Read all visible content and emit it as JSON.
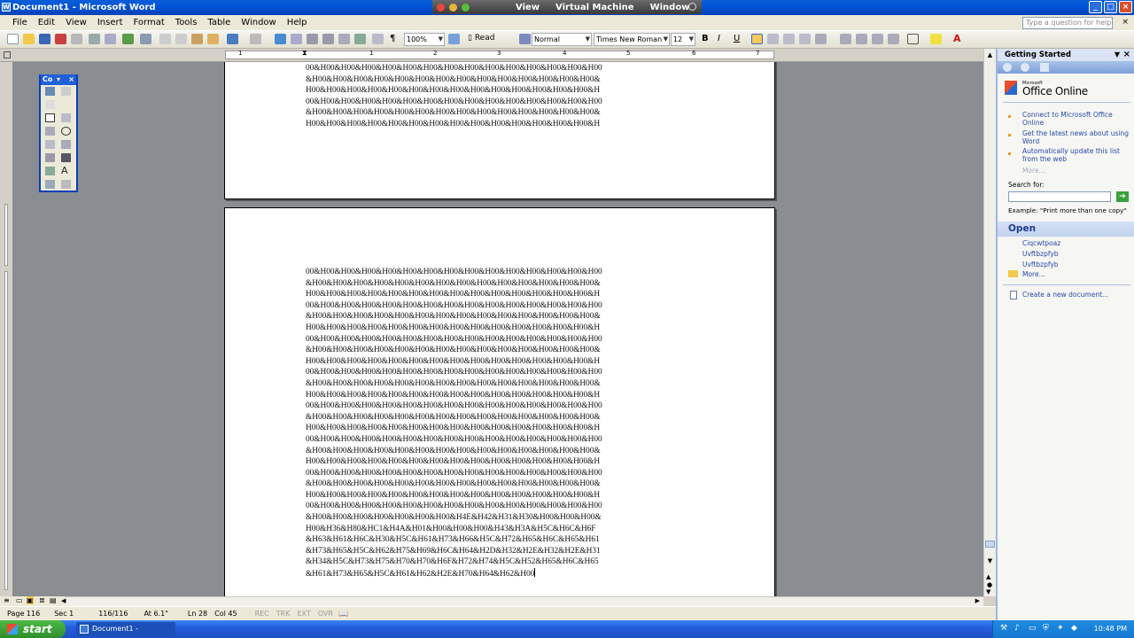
{
  "window": {
    "title": "Document1 - Microsoft Word",
    "controls": [
      "minimize",
      "maximize",
      "close"
    ]
  },
  "host_menu": {
    "items": [
      "View",
      "Virtual Machine",
      "Window"
    ]
  },
  "menu": {
    "items": [
      "File",
      "Edit",
      "View",
      "Insert",
      "Format",
      "Tools",
      "Table",
      "Window",
      "Help"
    ],
    "help_placeholder": "Type a question for help"
  },
  "toolbar": {
    "zoom": "100%",
    "read": "Read",
    "style": "Normal",
    "font": "Times New Roman",
    "size": "12"
  },
  "ruler": {
    "labels": [
      "1",
      "1",
      "2",
      "3",
      "4",
      "5",
      "6",
      "7"
    ]
  },
  "float_toolbar": {
    "title": "Co"
  },
  "document": {
    "page1_lines": [
      "00&H00&H00&H00&H00&H00&H00&H00&H00&H00&H00&H00&H00&H00&H00",
      "&H00&H00&H00&H00&H00&H00&H00&H00&H00&H00&H00&H00&H00&H00&",
      "H00&H00&H00&H00&H00&H00&H00&H00&H00&H00&H00&H00&H00&H00&H",
      "00&H00&H00&H00&H00&H00&H00&H00&H00&H00&H00&H00&H00&H00&H00",
      "&H00&H00&H00&H00&H00&H00&H00&H00&H00&H00&H00&H00&H00&H00&",
      "H00&H00&H00&H00&H00&H00&H00&H00&H00&H00&H00&H00&H00&H00&H"
    ],
    "page2_lines": [
      "00&H00&H00&H00&H00&H00&H00&H00&H00&H00&H00&H00&H00&H00&H00",
      "&H00&H00&H00&H00&H00&H00&H00&H00&H00&H00&H00&H00&H00&H00&",
      "H00&H00&H00&H00&H00&H00&H00&H00&H00&H00&H00&H00&H00&H00&H",
      "00&H00&H00&H00&H00&H00&H00&H00&H00&H00&H00&H00&H00&H00&H00",
      "&H00&H00&H00&H00&H00&H00&H00&H00&H00&H00&H00&H00&H00&H00&",
      "H00&H00&H00&H00&H00&H00&H00&H00&H00&H00&H00&H00&H00&H00&H",
      "00&H00&H00&H00&H00&H00&H00&H00&H00&H00&H00&H00&H00&H00&H00",
      "&H00&H00&H00&H00&H00&H00&H00&H00&H00&H00&H00&H00&H00&H00&",
      "H00&H00&H00&H00&H00&H00&H00&H00&H00&H00&H00&H00&H00&H00&H",
      "00&H00&H00&H00&H00&H00&H00&H00&H00&H00&H00&H00&H00&H00&H00",
      "&H00&H00&H00&H00&H00&H00&H00&H00&H00&H00&H00&H00&H00&H00&",
      "H00&H00&H00&H00&H00&H00&H00&H00&H00&H00&H00&H00&H00&H00&H",
      "00&H00&H00&H00&H00&H00&H00&H00&H00&H00&H00&H00&H00&H00&H00",
      "&H00&H00&H00&H00&H00&H00&H00&H00&H00&H00&H00&H00&H00&H00&",
      "H00&H00&H00&H00&H00&H00&H00&H00&H00&H00&H00&H00&H00&H00&H",
      "00&H00&H00&H00&H00&H00&H00&H00&H00&H00&H00&H00&H00&H00&H00",
      "&H00&H00&H00&H00&H00&H00&H00&H00&H00&H00&H00&H00&H00&H00&",
      "H00&H00&H00&H00&H00&H00&H00&H00&H00&H00&H00&H00&H00&H00&H",
      "00&H00&H00&H00&H00&H00&H00&H00&H00&H00&H00&H00&H00&H00&H00",
      "&H00&H00&H00&H00&H00&H00&H00&H00&H00&H00&H00&H00&H00&H00&",
      "H00&H00&H00&H00&H00&H00&H00&H00&H00&H00&H00&H00&H00&H00&H",
      "00&H00&H00&H00&H00&H00&H00&H00&H00&H00&H00&H00&H00&H00&H00",
      "&H00&H00&H00&H00&H00&H00&H00&H4E&H42&H31&H30&H00&H00&H00&",
      "H00&H36&H80&HC1&H4A&H01&H00&H00&H00&H43&H3A&H5C&H6C&H6F",
      "&H63&H61&H6C&H30&H5C&H61&H73&H66&H5C&H72&H65&H6C&H65&H61",
      "&H73&H65&H5C&H62&H75&H69&H6C&H64&H2D&H32&H2E&H32&H2E&H31",
      "&H34&H5C&H73&H75&H70&H70&H6F&H72&H74&H5C&H52&H65&H6C&H65",
      "&H61&H73&H65&H5C&H61&H62&H2E&H70&H64&H62&H00"
    ]
  },
  "status": {
    "page": "Page 116",
    "sec": "Sec 1",
    "pages": "116/116",
    "at": "At 6.1\"",
    "ln": "Ln 28",
    "col": "Col 45",
    "rec": "REC",
    "trk": "TRK",
    "ext": "EXT",
    "ovr": "OVR"
  },
  "pane": {
    "title": "Getting Started",
    "brand": "Office Online",
    "brand_small": "Microsoft",
    "links": [
      "Connect to Microsoft Office Online",
      "Get the latest news about using Word",
      "Automatically update this list from the web",
      "More..."
    ],
    "search_label": "Search for:",
    "example": "Example: \"Print more than one copy\"",
    "open_header": "Open",
    "recent": [
      "Ciqcwtpoaz",
      "Uvftbzpfyb",
      "Uvftbzpfyb"
    ],
    "more": "More...",
    "create": "Create a new document..."
  },
  "taskbar": {
    "start": "start",
    "task": "Document1 - Microsof...",
    "time": "10:48 PM"
  }
}
